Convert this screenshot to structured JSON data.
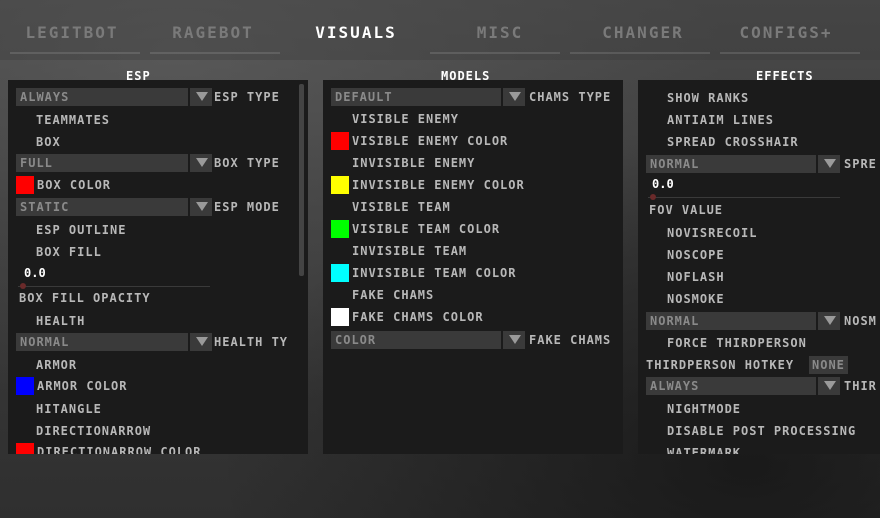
{
  "tabs": [
    "LEGITBOT",
    "RAGEBOT",
    "VISUALS",
    "MISC",
    "CHANGER",
    "CONFIGS+"
  ],
  "panels": {
    "esp": {
      "title": "ESP",
      "type_combo": "ALWAYS",
      "type_label": "ESP TYPE",
      "teammates": "TEAMMATES",
      "box": "BOX",
      "box_type_combo": "FULL",
      "box_type_label": "BOX TYPE",
      "box_color": "BOX COLOR",
      "mode_combo": "STATIC",
      "mode_label": "ESP MODE",
      "outline": "ESP OUTLINE",
      "box_fill": "BOX FILL",
      "fill_value": "0.0",
      "fill_opacity": "BOX FILL OPACITY",
      "health": "HEALTH",
      "health_combo": "NORMAL",
      "health_label": "HEALTH TY",
      "armor": "ARMOR",
      "armor_color": "ARMOR COLOR",
      "hitangle": "HITANGLE",
      "direction_arrow": "DIRECTIONARROW",
      "direction_arrow_color": "DIRECTIONARROW COLOR"
    },
    "models": {
      "title": "MODELS",
      "chams_combo": "DEFAULT",
      "chams_label": "CHAMS TYPE",
      "visible_enemy": "VISIBLE ENEMY",
      "visible_enemy_color": "VISIBLE ENEMY COLOR",
      "invisible_enemy": "INVISIBLE ENEMY",
      "invisible_enemy_color": "INVISIBLE ENEMY COLOR",
      "visible_team": "VISIBLE TEAM",
      "visible_team_color": "VISIBLE TEAM COLOR",
      "invisible_team": "INVISIBLE TEAM",
      "invisible_team_color": "INVISIBLE TEAM COLOR",
      "fake_chams": "FAKE CHAMS",
      "fake_chams_color": "FAKE CHAMS COLOR",
      "fake_combo": "COLOR",
      "fake_label": "FAKE CHAMS"
    },
    "effects": {
      "title": "EFFECTS",
      "show_ranks": "SHOW RANKS",
      "antiaim_lines": "ANTIAIM LINES",
      "spread_crosshair": "SPREAD CROSSHAIR",
      "spread_combo": "NORMAL",
      "spread_label": "SPRE",
      "fov_value": "0.0",
      "fov_label": "FOV VALUE",
      "novisrecoil": "NOVISRECOIL",
      "noscope": "NOSCOPE",
      "noflash": "NOFLASH",
      "nosmoke": "NOSMOKE",
      "nosmoke_combo": "NORMAL",
      "nosmoke_label": "NOSM",
      "force_thirdperson": "FORCE THIRDPERSON",
      "thirdperson_hotkey": "THIRDPERSON HOTKEY",
      "hotkey_value": "NONE",
      "third_combo": "ALWAYS",
      "third_label": "THIR",
      "nightmode": "NIGHTMODE",
      "disable_pp": "DISABLE POST PROCESSING",
      "watermark": "WATERMARK"
    }
  },
  "colors": {
    "red": "#ff0000",
    "yellow": "#ffff00",
    "green": "#00ff00",
    "cyan": "#00ffff",
    "white": "#ffffff",
    "blue": "#0000ff"
  }
}
